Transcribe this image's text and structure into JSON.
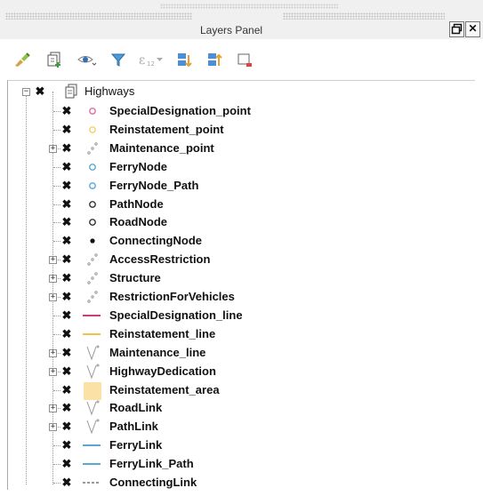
{
  "panel": {
    "title": "Layers Panel",
    "float_icon": "float-window-icon",
    "close_icon": "close-icon",
    "close_label": "✕"
  },
  "toolbar": [
    {
      "name": "style-manager-icon"
    },
    {
      "name": "add-group-icon"
    },
    {
      "name": "visibility-eye-icon"
    },
    {
      "name": "filter-legend-icon"
    },
    {
      "name": "filter-expression-icon"
    },
    {
      "name": "expand-all-icon"
    },
    {
      "name": "collapse-all-icon"
    },
    {
      "name": "remove-layer-icon"
    }
  ],
  "group": {
    "label": "Highways",
    "expander": "⊟",
    "checked_mark": "✖"
  },
  "layers": [
    {
      "label": "SpecialDesignation_point",
      "symbol": "circle-hollow",
      "color": "#e06c9f",
      "expander": ""
    },
    {
      "label": "Reinstatement_point",
      "symbol": "circle-hollow",
      "color": "#f3cf6b",
      "expander": ""
    },
    {
      "label": "Maintenance_point",
      "symbol": "dots",
      "color": "#999999",
      "expander": "+"
    },
    {
      "label": "FerryNode",
      "symbol": "circle-hollow",
      "color": "#58a8d6",
      "expander": ""
    },
    {
      "label": "FerryNode_Path",
      "symbol": "circle-hollow",
      "color": "#58a8d6",
      "expander": ""
    },
    {
      "label": "PathNode",
      "symbol": "circle-hollow",
      "color": "#333333",
      "expander": ""
    },
    {
      "label": "RoadNode",
      "symbol": "circle-hollow",
      "color": "#333333",
      "expander": ""
    },
    {
      "label": "ConnectingNode",
      "symbol": "circle-filled",
      "color": "#111111",
      "expander": ""
    },
    {
      "label": "AccessRestriction",
      "symbol": "dots",
      "color": "#999999",
      "expander": "+"
    },
    {
      "label": "Structure",
      "symbol": "dots",
      "color": "#999999",
      "expander": "+"
    },
    {
      "label": "RestrictionForVehicles",
      "symbol": "dots",
      "color": "#999999",
      "expander": "+"
    },
    {
      "label": "SpecialDesignation_line",
      "symbol": "line",
      "color": "#d23a7c",
      "expander": ""
    },
    {
      "label": "Reinstatement_line",
      "symbol": "line",
      "color": "#f0c24a",
      "expander": ""
    },
    {
      "label": "Maintenance_line",
      "symbol": "vee",
      "color": "#999999",
      "expander": "+"
    },
    {
      "label": "HighwayDedication",
      "symbol": "vee",
      "color": "#999999",
      "expander": "+"
    },
    {
      "label": "Reinstatement_area",
      "symbol": "fill",
      "color": "#fce1a6",
      "expander": ""
    },
    {
      "label": "RoadLink",
      "symbol": "vee",
      "color": "#999999",
      "expander": "+"
    },
    {
      "label": "PathLink",
      "symbol": "vee",
      "color": "#999999",
      "expander": "+"
    },
    {
      "label": "FerryLink",
      "symbol": "line",
      "color": "#58a8d6",
      "expander": ""
    },
    {
      "label": "FerryLink_Path",
      "symbol": "line",
      "color": "#58a8d6",
      "expander": ""
    },
    {
      "label": "ConnectingLink",
      "symbol": "dashed",
      "color": "#333333",
      "expander": ""
    }
  ]
}
